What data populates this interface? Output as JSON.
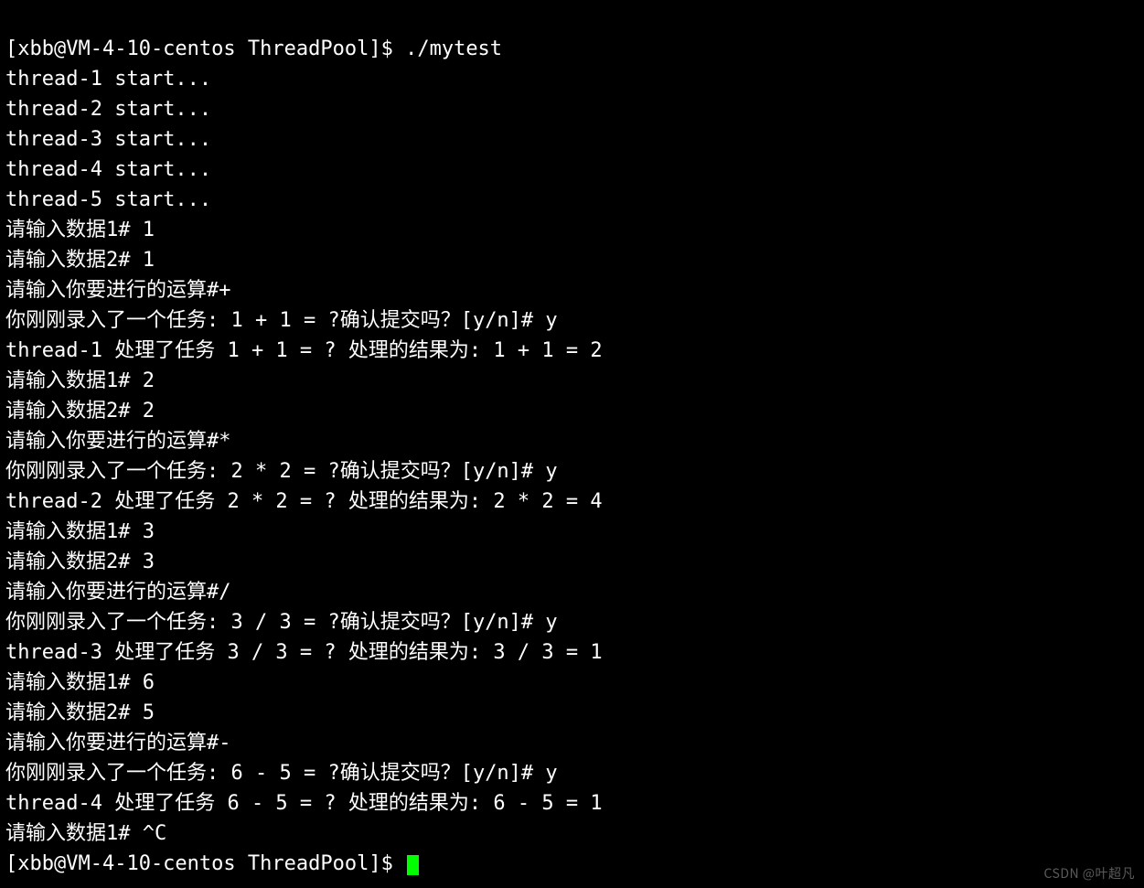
{
  "prompt": {
    "user": "xbb",
    "host": "VM-4-10-centos",
    "cwd": "ThreadPool",
    "symbol": "$"
  },
  "prompt_full": "[xbb@VM-4-10-centos ThreadPool]$ ",
  "command": "./mytest",
  "lines": [
    "[xbb@VM-4-10-centos ThreadPool]$ ./mytest",
    "thread-1 start...",
    "thread-2 start...",
    "thread-3 start...",
    "thread-4 start...",
    "thread-5 start...",
    "请输入数据1# 1",
    "请输入数据2# 1",
    "请输入你要进行的运算#+",
    "你刚刚录入了一个任务: 1 + 1 = ?确认提交吗？[y/n]# y",
    "thread-1 处理了任务 1 + 1 = ? 处理的结果为: 1 + 1 = 2",
    "请输入数据1# 2",
    "请输入数据2# 2",
    "请输入你要进行的运算#*",
    "你刚刚录入了一个任务: 2 * 2 = ?确认提交吗？[y/n]# y",
    "thread-2 处理了任务 2 * 2 = ? 处理的结果为: 2 * 2 = 4",
    "请输入数据1# 3",
    "请输入数据2# 3",
    "请输入你要进行的运算#/",
    "你刚刚录入了一个任务: 3 / 3 = ?确认提交吗？[y/n]# y",
    "thread-3 处理了任务 3 / 3 = ? 处理的结果为: 3 / 3 = 1",
    "请输入数据1# 6",
    "请输入数据2# 5",
    "请输入你要进行的运算#-",
    "你刚刚录入了一个任务: 6 - 5 = ?确认提交吗？[y/n]# y",
    "thread-4 处理了任务 6 - 5 = ? 处理的结果为: 6 - 5 = 1",
    "请输入数据1# ^C"
  ],
  "interrupt": "^C",
  "watermark": "CSDN @叶超凡"
}
